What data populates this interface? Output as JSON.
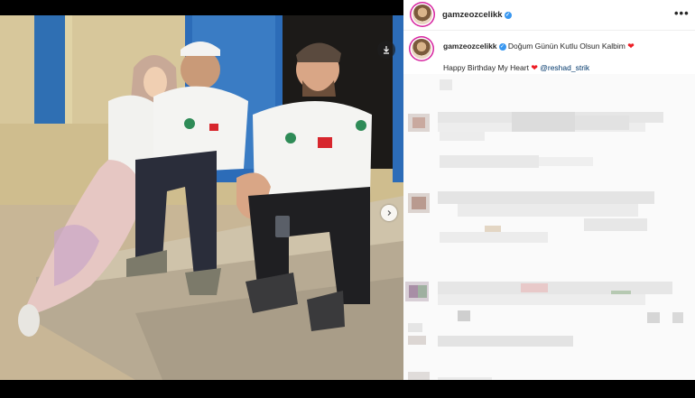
{
  "post": {
    "username": "gamzeozcelikk",
    "more_icon": "more-horizontal-icon",
    "save_icon": "bookmark-icon",
    "next_icon": "chevron-right-icon"
  },
  "caption": {
    "username": "gamzeozcelikk",
    "text": "Doğum Günün Kutlu Olsun Kalbim",
    "line2": "Happy Birthday My Heart",
    "mention": "@reshad_strik",
    "heart": "❤"
  },
  "colors": {
    "verified": "#3897f0",
    "heart": "#ed1c24",
    "mention": "#00376b",
    "story_ring": "#d6249f"
  }
}
